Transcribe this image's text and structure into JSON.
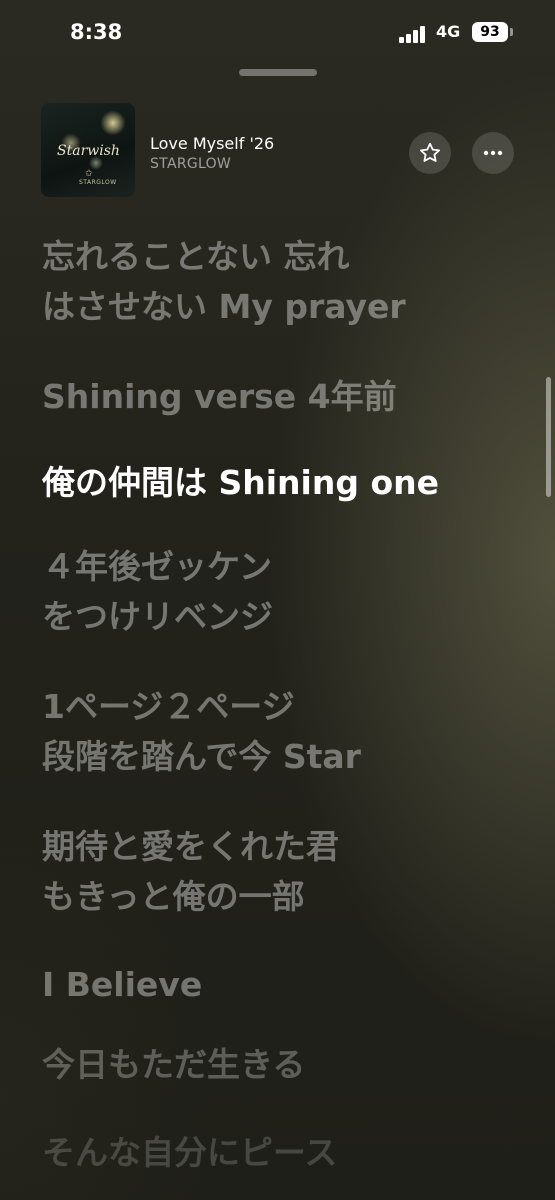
{
  "status_bar": {
    "time": "8:38",
    "network": "4G",
    "battery": "93"
  },
  "now_playing": {
    "title": "Love Myself '26",
    "artist": "STARGLOW",
    "artwork": {
      "title": "Starwish",
      "logo_text": "STARGLOW"
    },
    "favorite_icon": "star-outline-icon",
    "more_icon": "ellipsis-icon"
  },
  "lyrics": [
    {
      "lines": [
        "忘れることない 忘れ",
        "はさせない My prayer"
      ],
      "active": false
    },
    {
      "lines": [
        "Shining verse 4年前"
      ],
      "active": false
    },
    {
      "lines": [
        "俺の仲間は Shining one"
      ],
      "active": true
    },
    {
      "lines": [
        "４年後ゼッケン",
        "をつけリベンジ"
      ],
      "active": false
    },
    {
      "lines": [
        "1ページ２ページ",
        "段階を踏んで今 Star"
      ],
      "active": false
    },
    {
      "lines": [
        "期待と愛をくれた君",
        "もきっと俺の一部"
      ],
      "active": false
    },
    {
      "lines": [
        "I Believe"
      ],
      "active": false
    },
    {
      "lines": [
        "今日もただ生きる"
      ],
      "active": false
    },
    {
      "lines": [
        "そんな自分にピース"
      ],
      "active": false
    }
  ],
  "colors": {
    "active_lyric": "#ffffff",
    "inactive_lyric": "rgba(255,255,255,0.38)",
    "background": "#23231c"
  }
}
